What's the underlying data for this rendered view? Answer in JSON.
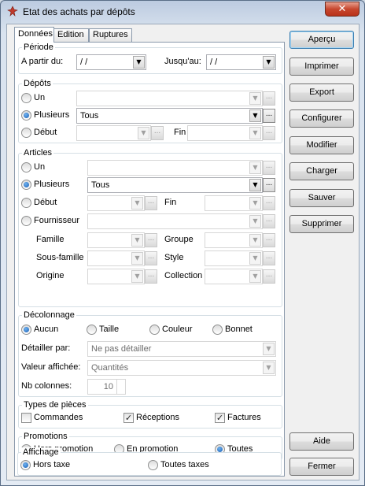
{
  "window": {
    "title": "Etat des achats par dépôts",
    "close_label": "✕"
  },
  "tabs": [
    "Données",
    "Edition",
    "Ruptures"
  ],
  "periode": {
    "title": "Période",
    "from_label": "A partir du:",
    "from_value": " / /",
    "to_label": "Jusqu'au:",
    "to_value": " / /"
  },
  "depots": {
    "title": "Dépôts",
    "un_label": "Un",
    "plusieurs_label": "Plusieurs",
    "debut_label": "Début",
    "fin_label": "Fin",
    "plusieurs_value": "Tous",
    "selected": "plusieurs"
  },
  "articles": {
    "title": "Articles",
    "un_label": "Un",
    "plusieurs_label": "Plusieurs",
    "debut_label": "Début",
    "fin_label": "Fin",
    "fournisseur_label": "Fournisseur",
    "famille_label": "Famille",
    "groupe_label": "Groupe",
    "sousfamille_label": "Sous-famille",
    "style_label": "Style",
    "origine_label": "Origine",
    "collection_label": "Collection",
    "plusieurs_value": "Tous",
    "selected": "plusieurs"
  },
  "decolonnage": {
    "title": "Décolonnage",
    "options": [
      "Aucun",
      "Taille",
      "Couleur",
      "Bonnet"
    ],
    "selected": "Aucun",
    "detailler_label": "Détailler par:",
    "detailler_value": "Ne pas détailler",
    "valeur_label": "Valeur affichée:",
    "valeur_value": "Quantités",
    "nbcol_label": "Nb colonnes:",
    "nbcol_value": "10"
  },
  "types_pieces": {
    "title": "Types de pièces",
    "commandes_label": "Commandes",
    "commandes_checked": false,
    "receptions_label": "Réceptions",
    "receptions_checked": true,
    "factures_label": "Factures",
    "factures_checked": true
  },
  "promotions": {
    "title": "Promotions",
    "options": [
      "Hors promotion",
      "En promotion",
      "Toutes"
    ],
    "selected": "Toutes"
  },
  "affichage": {
    "title": "Affichage",
    "options": [
      "Hors taxe",
      "Toutes taxes"
    ],
    "selected": "Hors taxe"
  },
  "buttons": {
    "apercu": "Aperçu",
    "imprimer": "Imprimer",
    "export": "Export",
    "configurer": "Configurer",
    "modifier": "Modifier",
    "charger": "Charger",
    "sauver": "Sauver",
    "supprimer": "Supprimer",
    "aide": "Aide",
    "fermer": "Fermer"
  },
  "glyphs": {
    "dropdown": "▼",
    "ellipsis": "...",
    "check": "✓"
  }
}
